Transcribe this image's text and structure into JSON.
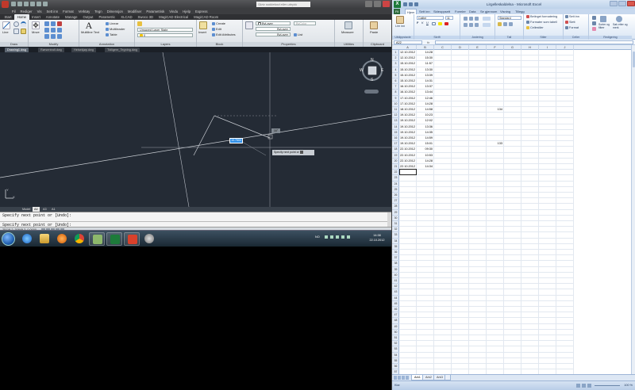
{
  "acad": {
    "search_placeholder": "Skriv nøkkelord eller uttrykk",
    "menus": [
      "Fil",
      "Rediger",
      "Vis",
      "Sett inn",
      "Format",
      "Verktøy",
      "Tegn",
      "Dimensjon",
      "Modifiser",
      "Parametrisk",
      "Vindu",
      "Hjelp",
      "Express"
    ],
    "tabs": [
      "Start",
      "Home",
      "Insert",
      "Annotate",
      "Manage",
      "Output",
      "Parametric",
      "XLCAD",
      "Swoco 3D",
      "MagiCAD Electrical",
      "MagiCAD Room"
    ],
    "ribbon": {
      "draw": {
        "title": "Draw",
        "line": "Line",
        "polyline": "Polyline",
        "circle": "Circle",
        "arc": "Arc"
      },
      "modify": {
        "title": "Modify",
        "move": "Move"
      },
      "annotation": {
        "title": "Annotation",
        "mtext": "Multiline Text",
        "linear": "Linear",
        "mleader": "Multileader",
        "table": "Table"
      },
      "layers": {
        "title": "Layers",
        "state": "Unsaved Layer State",
        "current": "0"
      },
      "block": {
        "title": "Block",
        "insert": "Insert",
        "create": "Create",
        "edit": "Edit",
        "edit_attr": "Edit Attributes"
      },
      "properties": {
        "title": "Properties",
        "color": "ByLayer",
        "linetype": "ByLayer",
        "lineweight": "ByLayer",
        "list": "List",
        "plot": "ByColor",
        "match": "Match Properties"
      },
      "utilities": {
        "title": "Utilities",
        "measure": "Measure"
      },
      "clipboard": {
        "title": "Clipboard",
        "paste": "Paste"
      }
    },
    "doc_tabs": [
      "Drawing1.dwg",
      "Rørsentralt.dwg",
      "Helsekjøp.dwg",
      "Tidligere_Tegning.dwg"
    ],
    "viewcube": {
      "n": "N",
      "s": "S",
      "e": "E",
      "w": "W"
    },
    "coord_tip": "10.7500",
    "angle_tip": "16°",
    "prompt_tip": "Specify next point or",
    "ucs": {
      "x": "X",
      "y": "Y"
    },
    "layout_tabs": [
      "Model",
      "A4",
      "A3",
      "A1"
    ],
    "cmd_history": "Specify next point or [Undo]:",
    "cmd_current": "Specify next point or [Undo]:",
    "coords": "25118.2, 30849.3, 0.0000"
  },
  "taskbar": {
    "lang": "NO",
    "time": "14:38",
    "date": "22.10.2012"
  },
  "excel": {
    "title": "Lirgelleskaldelsa - Microsoft Excel",
    "tabs": [
      "Fil",
      "Hjem",
      "Sett inn",
      "Sideoppsett",
      "Formler",
      "Data",
      "Se gjennom",
      "Visning",
      "Tillegg"
    ],
    "ribbon": {
      "clipboard": {
        "title": "Utklippstavle",
        "paste": "Lim inn"
      },
      "font": {
        "title": "Skrift",
        "name": "Calibri",
        "size": "11"
      },
      "alignment": {
        "title": "Justering"
      },
      "number": {
        "title": "Tall",
        "format": "Standard"
      },
      "styles": {
        "title": "Stiler",
        "cond": "Betinget formatering",
        "table": "Formater som tabell",
        "cell": "Cellestiler"
      },
      "cells": {
        "title": "Celler",
        "insert": "Sett inn",
        "delete": "Slett",
        "format": "Format"
      },
      "editing": {
        "title": "Redigering",
        "sort": "Sorter og filtrer",
        "find": "Søk etter og merk"
      }
    },
    "name_box": "A22",
    "columns": [
      "A",
      "B",
      "C",
      "D",
      "E",
      "F",
      "G",
      "H",
      "I",
      "J"
    ],
    "rows": [
      {
        "a": "12.10.2012",
        "b": "14:28",
        "f": ""
      },
      {
        "a": "12.10.2012",
        "b": "15:30",
        "f": ""
      },
      {
        "a": "15.10.2012",
        "b": "11:57",
        "f": ""
      },
      {
        "a": "15.10.2012",
        "b": "13:30",
        "f": ""
      },
      {
        "a": "15.10.2012",
        "b": "13:39",
        "f": ""
      },
      {
        "a": "15.10.2012",
        "b": "14:31",
        "f": ""
      },
      {
        "a": "16.10.2012",
        "b": "13:37",
        "f": ""
      },
      {
        "a": "16.10.2012",
        "b": "13:44",
        "f": ""
      },
      {
        "a": "17.10.2012",
        "b": "12:46",
        "f": ""
      },
      {
        "a": "17.10.2012",
        "b": "14:28",
        "f": ""
      },
      {
        "a": "18.10.2012",
        "b": "14:58",
        "f": "134"
      },
      {
        "a": "19.10.2012",
        "b": "10:23",
        "f": ""
      },
      {
        "a": "19.10.2012",
        "b": "12:02",
        "f": ""
      },
      {
        "a": "19.10.2012",
        "b": "13:36",
        "f": ""
      },
      {
        "a": "19.10.2012",
        "b": "14:35",
        "f": ""
      },
      {
        "a": "19.10.2012",
        "b": "14:59",
        "f": ""
      },
      {
        "a": "19.10.2012",
        "b": "15:01",
        "f": "133"
      },
      {
        "a": "22.10.2012",
        "b": "09:30",
        "f": ""
      },
      {
        "a": "22.10.2012",
        "b": "10:53",
        "f": ""
      },
      {
        "a": "22.10.2012",
        "b": "14:28",
        "f": ""
      },
      {
        "a": "22.10.2012",
        "b": "14:34",
        "f": ""
      }
    ],
    "sheets": [
      "Ark1",
      "Ark2",
      "Ark3"
    ],
    "status": "Klar",
    "zoom": "100 %"
  }
}
